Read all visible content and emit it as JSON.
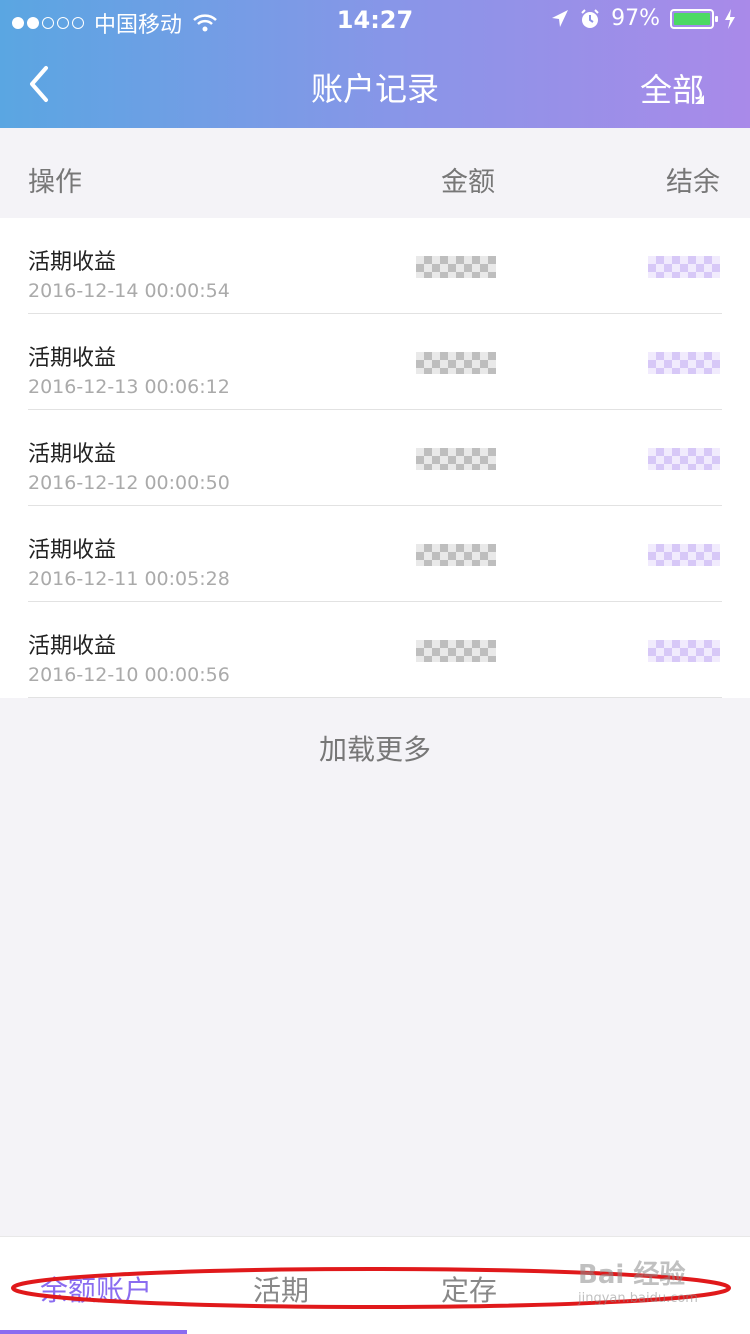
{
  "status_bar": {
    "carrier": "中国移动",
    "time": "14:27",
    "battery": "97%",
    "signal_filled": 2,
    "signal_total": 5,
    "icons": [
      "wifi-icon",
      "location-icon",
      "alarm-icon",
      "battery-icon",
      "charging-icon"
    ]
  },
  "nav": {
    "back_icon": "chevron-left-icon",
    "title": "账户记录",
    "filter_label": "全部"
  },
  "columns": {
    "operation": "操作",
    "amount": "金额",
    "balance": "结余"
  },
  "records": [
    {
      "title": "活期收益",
      "date": "2016-12-14 00:00:54"
    },
    {
      "title": "活期收益",
      "date": "2016-12-13 00:06:12"
    },
    {
      "title": "活期收益",
      "date": "2016-12-12 00:00:50"
    },
    {
      "title": "活期收益",
      "date": "2016-12-11 00:05:28"
    },
    {
      "title": "活期收益",
      "date": "2016-12-10 00:00:56"
    }
  ],
  "load_more": "加载更多",
  "tabs": [
    {
      "label": "余额账户",
      "active": true
    },
    {
      "label": "活期",
      "active": false
    },
    {
      "label": "定存",
      "active": false
    },
    {
      "label": "",
      "active": false
    }
  ],
  "watermark": {
    "brand": "Bai 经验",
    "url": "jingyan.baidu.com"
  },
  "colors": {
    "accent": "#8a6cf0",
    "header_start": "#5aa6e2",
    "header_end": "#a98ae9",
    "annotation": "#e0191b"
  }
}
